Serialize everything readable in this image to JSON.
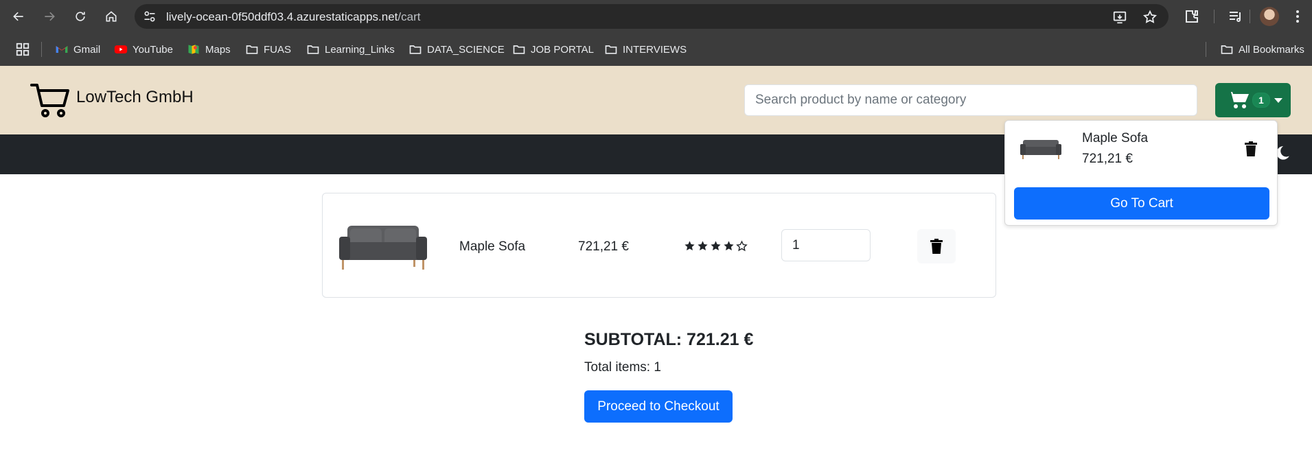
{
  "browser": {
    "url_host": "lively-ocean-0f50ddf03.4.azurestaticapps.net",
    "url_path": "/cart",
    "bookmarks": [
      {
        "label": "Gmail",
        "icon": "gmail-icon"
      },
      {
        "label": "YouTube",
        "icon": "youtube-icon"
      },
      {
        "label": "Maps",
        "icon": "maps-icon"
      },
      {
        "label": "FUAS",
        "icon": "folder-icon"
      },
      {
        "label": "Learning_Links",
        "icon": "folder-icon"
      },
      {
        "label": "DATA_SCIENCE",
        "icon": "folder-icon"
      },
      {
        "label": "JOB PORTAL",
        "icon": "folder-icon"
      },
      {
        "label": "INTERVIEWS",
        "icon": "folder-icon"
      }
    ],
    "all_bookmarks_label": "All Bookmarks"
  },
  "header": {
    "brand": "LowTech GmbH",
    "search_placeholder": "Search product by name or category",
    "cart_count": "1",
    "colors": {
      "header_bg": "#ebdfca",
      "cart_button": "#157347",
      "navbar": "#212529"
    }
  },
  "dropdown": {
    "item_name": "Maple Sofa",
    "item_price": "721,21 €",
    "go_to_cart_label": "Go To Cart"
  },
  "cart": {
    "items": [
      {
        "name": "Maple Sofa",
        "price": "721,21 €",
        "rating": 4,
        "rating_max": 5,
        "quantity": "1"
      }
    ],
    "subtotal": "SUBTOTAL: 721.21 €",
    "total_items": "Total items: 1",
    "checkout_label": "Proceed to Checkout",
    "colors": {
      "primary": "#0d6efd"
    }
  }
}
